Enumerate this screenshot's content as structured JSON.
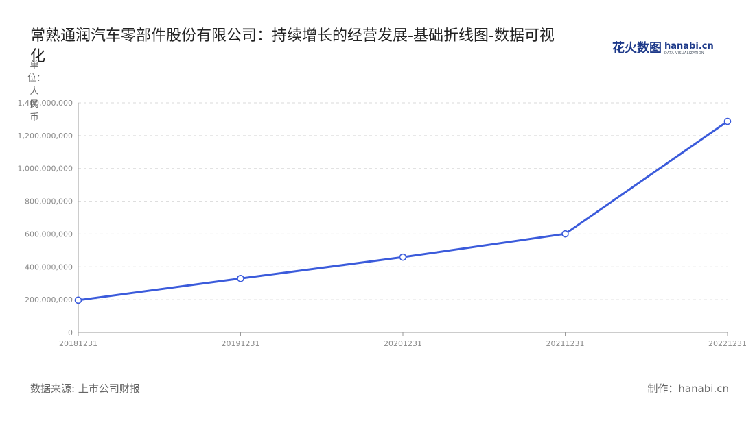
{
  "title": "常熟通润汽车零部件股份有限公司：持续增长的经营发展-基础折线图-数据可视化",
  "brand": {
    "cn": "花火数图",
    "en": "hanabi.cn",
    "en_sub": "DATA VISUALIZATION"
  },
  "unit_label": "单位：人民币",
  "footer": {
    "source": "数据来源: 上市公司财报",
    "maker": "制作：hanabi.cn"
  },
  "colors": {
    "line": "#3b5bdb",
    "grid": "#d9d9d9",
    "axis": "#999999"
  },
  "chart_data": {
    "type": "line",
    "x": [
      "20181231",
      "20191231",
      "20201231",
      "20211231",
      "20221231"
    ],
    "series": [
      {
        "values": [
          197000000,
          329000000,
          459000000,
          601000000,
          1287000000
        ]
      }
    ],
    "ylim": [
      0,
      1400000000
    ],
    "yticks": [
      0,
      200000000,
      400000000,
      600000000,
      800000000,
      1000000000,
      1200000000,
      1400000000
    ],
    "ytick_labels": [
      "0",
      "200,000,000",
      "400,000,000",
      "600,000,000",
      "800,000,000",
      "1,000,000,000",
      "1,200,000,000",
      "1,400,000,000"
    ],
    "grid": true,
    "legend": "none"
  }
}
